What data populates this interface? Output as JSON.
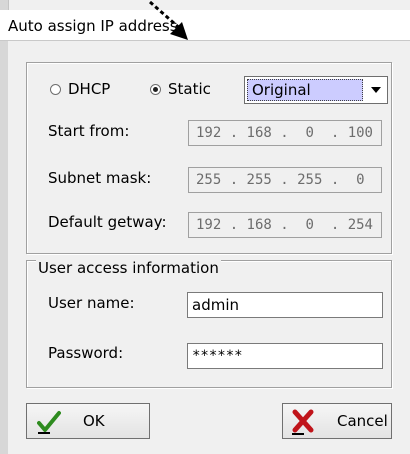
{
  "window": {
    "title": "Auto assign IP address"
  },
  "mode": {
    "dhcp_label": "DHCP",
    "static_label": "Static",
    "selected": "Static",
    "profile_selected": "Original"
  },
  "fields": {
    "start_label": "Start from:",
    "start_value": "192 . 168 .  0  . 100",
    "subnet_label": "Subnet mask:",
    "subnet_value": "255 . 255 . 255 .  0 ",
    "gateway_label": "Default getway:",
    "gateway_value": "192 . 168 .  0  . 254"
  },
  "user_access": {
    "legend": "User access information",
    "username_label": "User name:",
    "username_value": "admin",
    "password_label": "Password:",
    "password_value": "******"
  },
  "buttons": {
    "ok": "OK",
    "cancel": "Cancel"
  },
  "colors": {
    "dropdown_highlight": "#ccccff",
    "ok_icon": "#2e8b1f",
    "cancel_icon": "#c0141a"
  },
  "icons": {
    "ok": "checkmark-icon",
    "cancel": "red-x-icon",
    "dropdown": "chevron-down-icon",
    "pointer": "mouse-pointer-icon"
  }
}
